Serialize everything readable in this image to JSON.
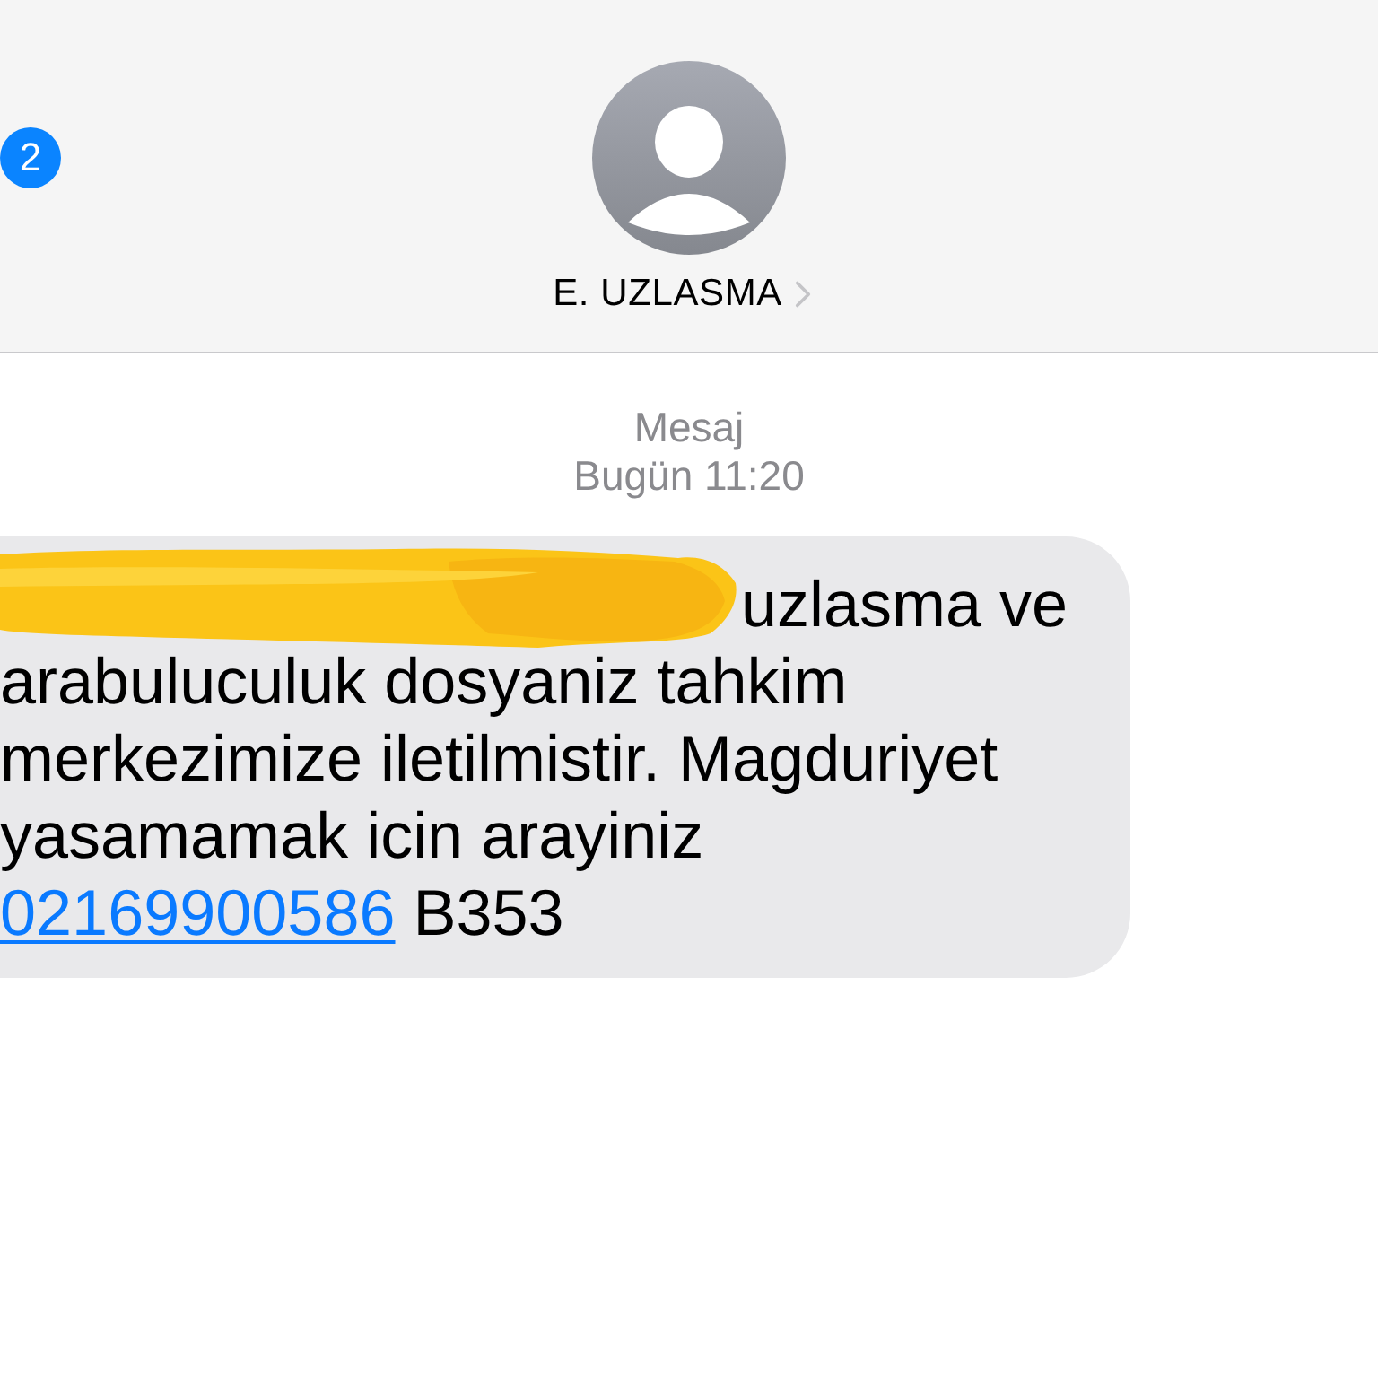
{
  "header": {
    "back_badge": "2",
    "contact_name": "E. UZLASMA"
  },
  "thread": {
    "label": "Mesaj",
    "timestamp": "Bugün 11:20"
  },
  "messages": [
    {
      "kind": "incoming",
      "redacted": true,
      "text": "uzlasma ve arabuluculuk dosyaniz tahkim merkezimize iletilmistir. Magduriyet yasamamak icin arayiniz",
      "link": "02169900586",
      "after_link": "B353"
    }
  ]
}
